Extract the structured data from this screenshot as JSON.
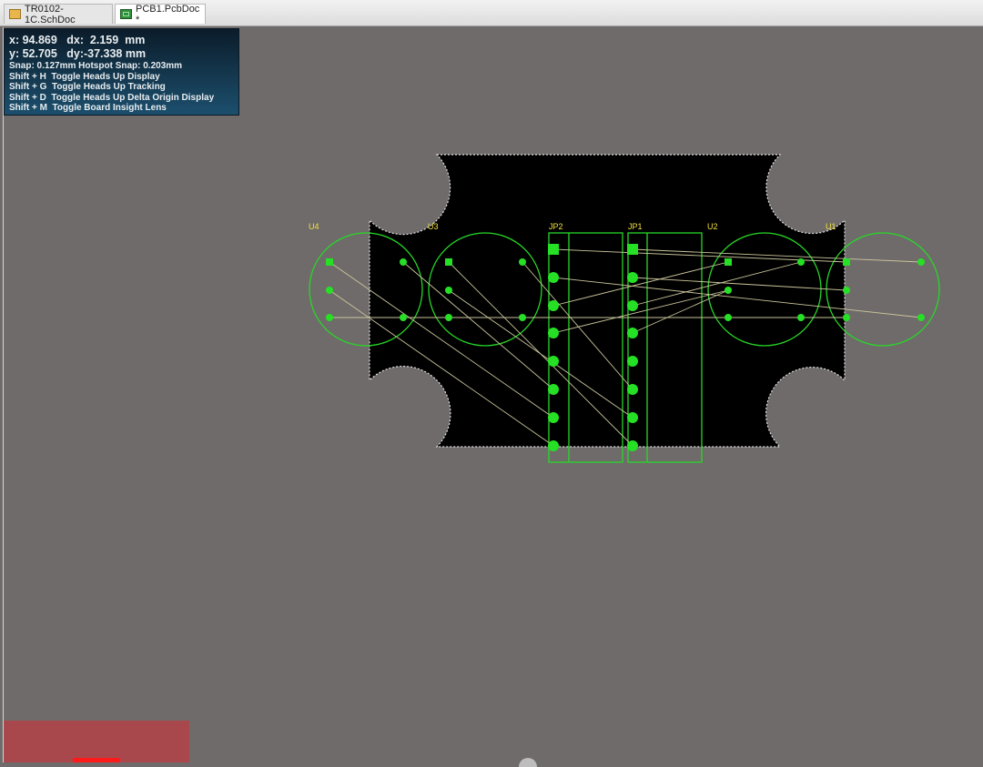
{
  "tabs": [
    {
      "label": "TR0102-1C.SchDoc",
      "icon": "schematic-doc-icon"
    },
    {
      "label": "PCB1.PcbDoc *",
      "icon": "pcb-doc-icon"
    }
  ],
  "hud": {
    "line1": "x: 94.869   dx:  2.159  mm",
    "line2": "y: 52.705   dy:-37.338 mm",
    "line3": "Snap: 0.127mm Hotspot Snap: 0.203mm",
    "line4": "Shift + H  Toggle Heads Up Display",
    "line5": "Shift + G  Toggle Heads Up Tracking",
    "line6": "Shift + D  Toggle Heads Up Delta Origin Display",
    "line7": "Shift + M  Toggle Board Insight Lens"
  },
  "components": {
    "u4": "U4",
    "u3": "U3",
    "jp2": "JP2",
    "jp1": "JP1",
    "u2": "U2",
    "u1": "U1"
  },
  "colors": {
    "workspace": "#6f6b6a",
    "board": "#000000",
    "overlay": "#27d827",
    "pad": "#25e025",
    "ratsnest": "#c9c49a",
    "designator": "#f2e03a"
  }
}
